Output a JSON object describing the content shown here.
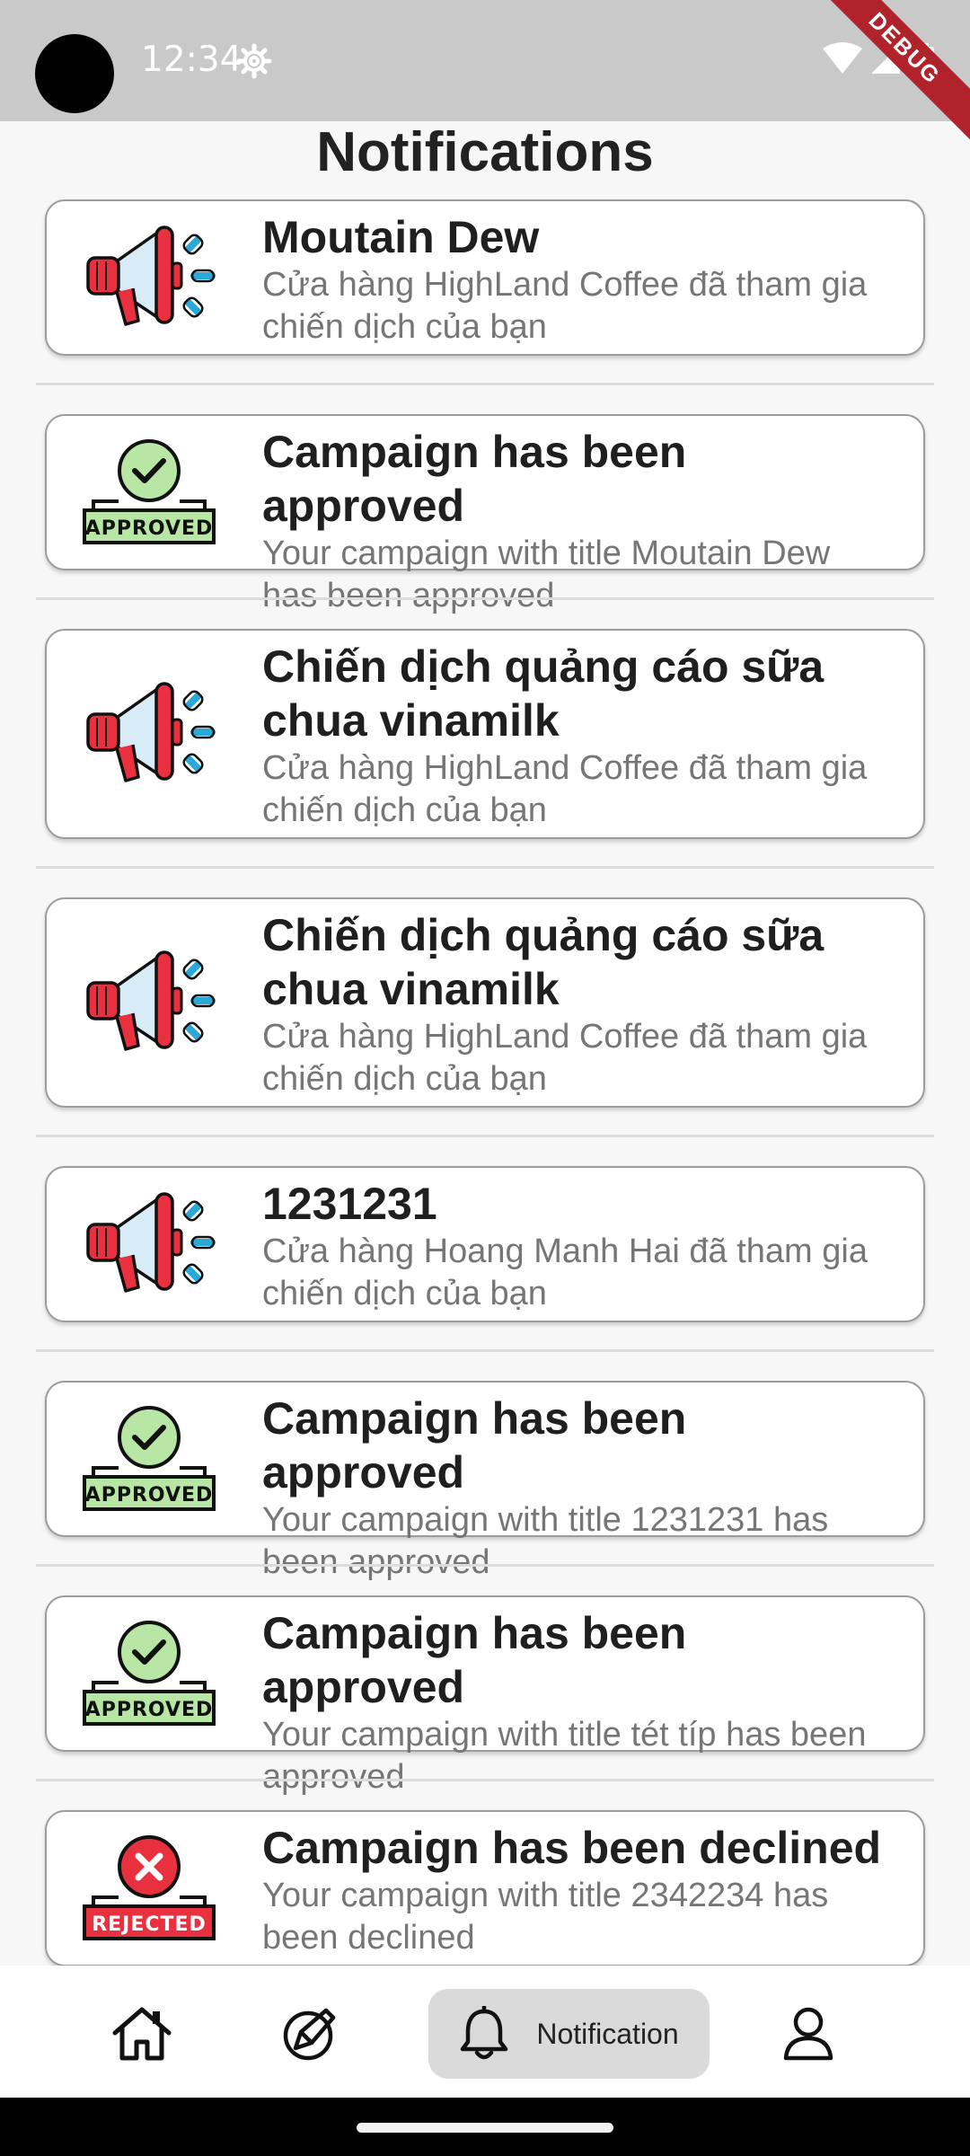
{
  "status_bar": {
    "time": "12:34",
    "debug_label": "DEBUG",
    "icons": [
      "settings-icon",
      "wifi-icon",
      "signal-icon",
      "battery-icon"
    ]
  },
  "page": {
    "title": "Notifications"
  },
  "notifications": [
    {
      "type": "megaphone",
      "title": "Moutain Dew",
      "body": "Cửa hàng HighLand Coffee đã tham gia chiến dịch của bạn"
    },
    {
      "type": "approved",
      "badge": "APPROVED",
      "title": "Campaign has been approved",
      "body": "Your campaign with title Moutain Dew has been approved"
    },
    {
      "type": "megaphone",
      "title": "Chiến dịch quảng cáo sữa chua vinamilk",
      "body": "Cửa hàng HighLand Coffee đã tham gia chiến dịch của bạn"
    },
    {
      "type": "megaphone",
      "title": "Chiến dịch quảng cáo sữa chua vinamilk",
      "body": "Cửa hàng HighLand Coffee đã tham gia chiến dịch của bạn"
    },
    {
      "type": "megaphone",
      "title": "1231231",
      "body": "Cửa hàng Hoang Manh Hai đã tham gia chiến dịch của bạn"
    },
    {
      "type": "approved",
      "badge": "APPROVED",
      "title": "Campaign has been approved",
      "body": "Your campaign with title 1231231 has been approved"
    },
    {
      "type": "approved",
      "badge": "APPROVED",
      "title": "Campaign has been approved",
      "body": "Your campaign with title tét típ has been approved"
    },
    {
      "type": "rejected",
      "badge": "REJECTED",
      "title": "Campaign has been declined",
      "body": "Your campaign with title 2342234 has been declined"
    }
  ],
  "bottom_nav": {
    "items": [
      {
        "icon": "home-icon",
        "label": ""
      },
      {
        "icon": "campaign-icon",
        "label": ""
      },
      {
        "icon": "bell-icon",
        "label": "Notification",
        "active": true
      },
      {
        "icon": "profile-icon",
        "label": ""
      }
    ]
  },
  "colors": {
    "status_bar": "#c9c9c9",
    "approved_green": "#b8e6a4",
    "rejected_red": "#e8303f",
    "active_nav": "#dadada"
  }
}
